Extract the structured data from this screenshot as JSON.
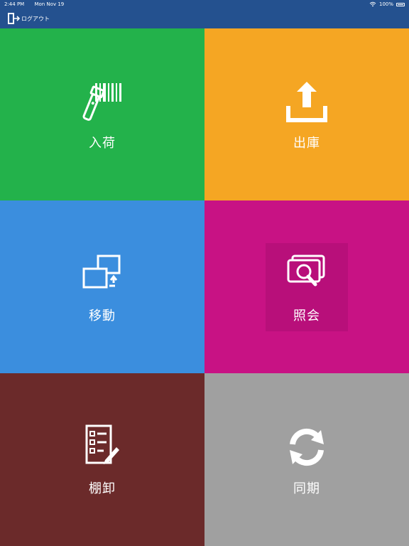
{
  "status_bar": {
    "time": "2:44 PM",
    "date": "Mon Nov 19",
    "battery_text": "100%"
  },
  "nav": {
    "logout_label": "ログアウト"
  },
  "tiles": [
    {
      "label": "入荷",
      "color": "#23b24b",
      "icon": "barcode-scanner-icon"
    },
    {
      "label": "出庫",
      "color": "#f5a623",
      "icon": "upload-icon"
    },
    {
      "label": "移動",
      "color": "#3b8ede",
      "icon": "move-windows-icon"
    },
    {
      "label": "照会",
      "color": "#c81284",
      "icon": "search-images-icon"
    },
    {
      "label": "棚卸",
      "color": "#6b2a2a",
      "icon": "checklist-icon"
    },
    {
      "label": "同期",
      "color": "#a0a0a0",
      "icon": "sync-icon"
    }
  ]
}
